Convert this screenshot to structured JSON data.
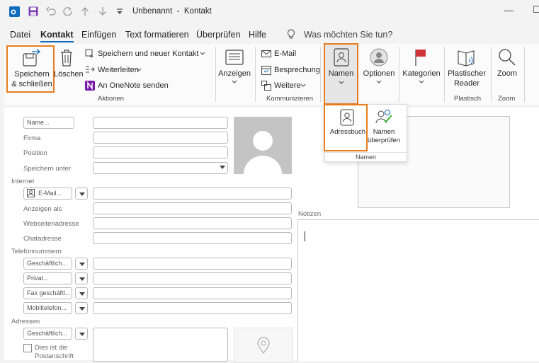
{
  "titlebar": {
    "title": "Unbenannt  -  Kontakt",
    "minimize": "—",
    "restore": "☐"
  },
  "tabs": [
    {
      "label": "Datei"
    },
    {
      "label": "Kontakt"
    },
    {
      "label": "Einfügen"
    },
    {
      "label": "Text formatieren"
    },
    {
      "label": "Überprüfen"
    },
    {
      "label": "Hilfe"
    }
  ],
  "tellme": "Was möchten Sie tun?",
  "ribbon": {
    "aktionen": {
      "save_close_l1": "Speichern",
      "save_close_l2": "& schließen",
      "delete": "Löschen",
      "save_new": "Speichern und neuer Kontakt",
      "forward": "Weiterleiten",
      "onenote": "An OneNote senden",
      "group": "Aktionen"
    },
    "anzeigen": {
      "label": "Anzeigen"
    },
    "kommunizieren": {
      "email": "E-Mail",
      "meeting": "Besprechung",
      "more": "Weitere",
      "group": "Kommunizieren"
    },
    "namen": {
      "label": "Namen"
    },
    "optionen": {
      "label": "Optionen"
    },
    "kategorien": {
      "label": "Kategorien"
    },
    "plastisch": {
      "l1": "Plastischer",
      "l2": "Reader",
      "group": "Plastisch"
    },
    "zoom": {
      "label": "Zoom",
      "group": "Zoom"
    }
  },
  "namen_panel": {
    "adressbuch": "Adressbuch",
    "check_l1": "Namen",
    "check_l2": "überprüfen",
    "group": "Namen"
  },
  "form": {
    "name_btn": "Name...",
    "firma": "Firma",
    "position": "Position",
    "speichern_unter": "Speichern unter",
    "internet": "Internet",
    "email_btn": "E-Mail...",
    "anzeigen_als": "Anzeigen als",
    "webseite": "Webseitenadresse",
    "chat": "Chatadresse",
    "telefon": "Telefonnummern",
    "phones": [
      "Geschäftlich...",
      "Privat...",
      "Fax geschäftl...",
      "Mobiltelefon..."
    ],
    "adressen": "Adressen",
    "addr_btn": "Geschäftlich...",
    "postanschrift_l1": "Dies ist die",
    "postanschrift_l2": "Postanschrift",
    "notizen": "Notizen"
  }
}
